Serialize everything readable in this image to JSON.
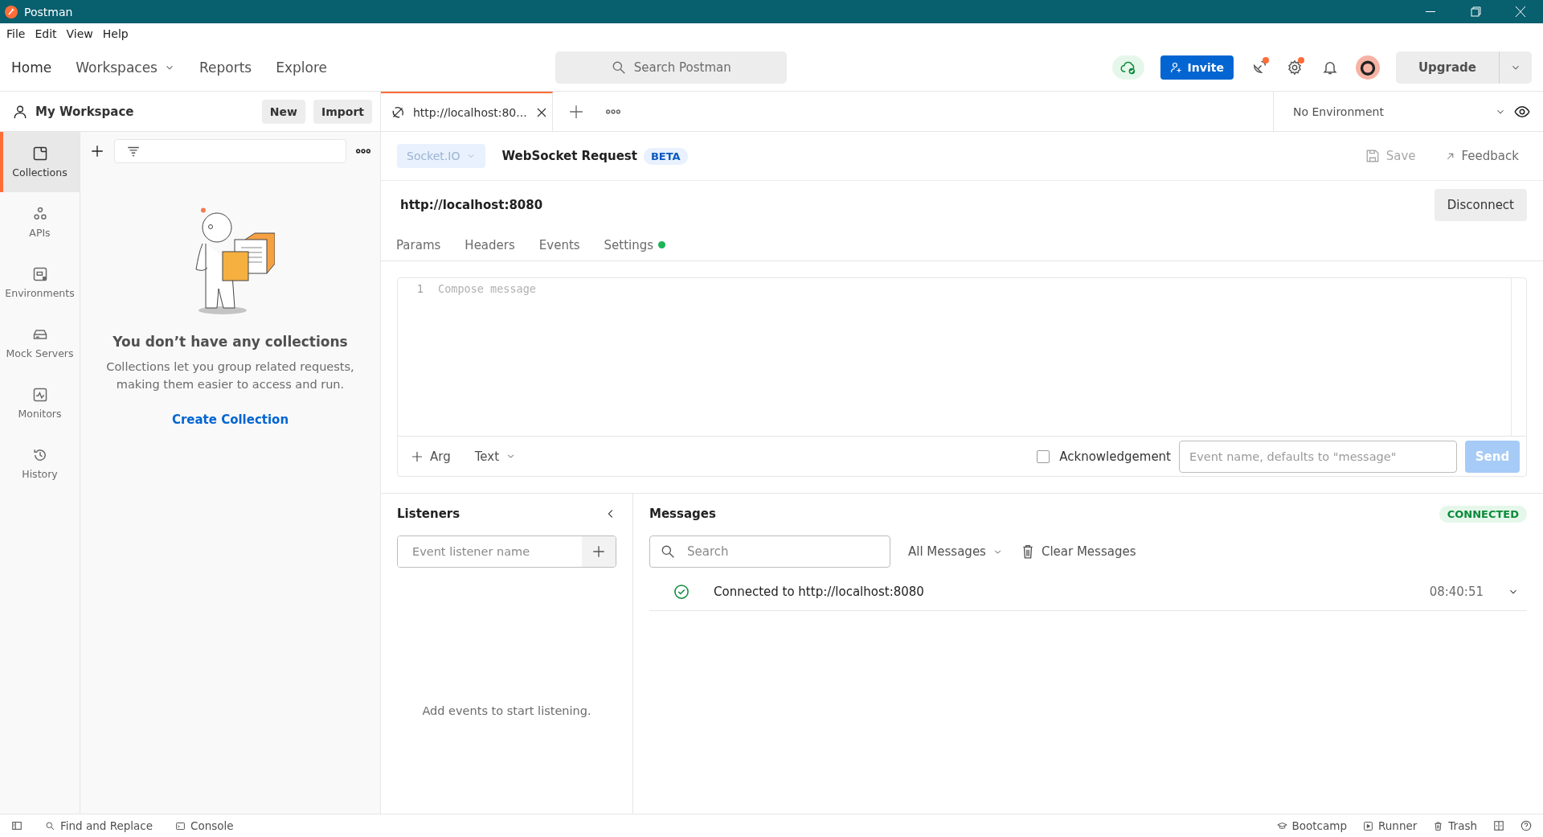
{
  "title_bar": {
    "app_title": "Postman"
  },
  "menu": [
    "File",
    "Edit",
    "View",
    "Help"
  ],
  "header": {
    "nav": [
      {
        "label": "Home",
        "has_caret": false
      },
      {
        "label": "Workspaces",
        "has_caret": true
      },
      {
        "label": "Reports",
        "has_caret": false
      },
      {
        "label": "Explore",
        "has_caret": false
      }
    ],
    "search_placeholder": "Search Postman",
    "invite": "Invite",
    "upgrade": "Upgrade"
  },
  "workspace": {
    "title": "My Workspace",
    "new": "New",
    "import": "Import"
  },
  "sidebar": {
    "items": [
      {
        "kind": "collections",
        "label": "Collections",
        "selected": true
      },
      {
        "kind": "apis",
        "label": "APIs",
        "selected": false
      },
      {
        "kind": "environments",
        "label": "Environments",
        "selected": false
      },
      {
        "kind": "mock",
        "label": "Mock Servers",
        "selected": false
      },
      {
        "kind": "monitors",
        "label": "Monitors",
        "selected": false
      },
      {
        "kind": "history",
        "label": "History",
        "selected": false
      }
    ]
  },
  "collections_empty": {
    "heading": "You don’t have any collections",
    "text": "Collections let you group related requests, making them easier to access and run.",
    "action": "Create Collection"
  },
  "tabs": [
    {
      "label": "http://localhost:80...",
      "selected": true
    }
  ],
  "environment": {
    "value": "No Environment"
  },
  "request": {
    "protocol": "Socket.IO",
    "title": "WebSocket Request",
    "badge": "BETA",
    "save": "Save",
    "feedback": "Feedback",
    "url": "http://localhost:8080",
    "disconnect": "Disconnect",
    "subtabs": [
      {
        "label": "Params",
        "has_dot": false
      },
      {
        "label": "Headers",
        "has_dot": false
      },
      {
        "label": "Events",
        "has_dot": false
      },
      {
        "label": "Settings",
        "has_dot": true
      }
    ]
  },
  "editor": {
    "line_number": "1",
    "placeholder": "Compose message"
  },
  "composer": {
    "arg": "Arg",
    "format": "Text",
    "acknowledgement": {
      "label": "Acknowledgement",
      "checked": false
    },
    "event_placeholder": "Event name, defaults to \"message\"",
    "send": "Send",
    "send_disabled": true
  },
  "listeners": {
    "title": "Listeners",
    "placeholder": "Event listener name",
    "empty": "Add events to start listening."
  },
  "messages": {
    "title": "Messages",
    "status": "CONNECTED",
    "search_placeholder": "Search",
    "filter": "All Messages",
    "clear": "Clear Messages",
    "rows": [
      {
        "text": "Connected to http://localhost:8080",
        "time": "08:40:51"
      }
    ]
  },
  "status_bar": {
    "left": [
      {
        "kind": "search",
        "label": "Find and Replace"
      },
      {
        "kind": "console",
        "label": "Console"
      }
    ],
    "right": [
      {
        "kind": "bootcamp",
        "label": "Bootcamp"
      },
      {
        "kind": "runner",
        "label": "Runner"
      },
      {
        "kind": "trash",
        "label": "Trash"
      }
    ]
  }
}
